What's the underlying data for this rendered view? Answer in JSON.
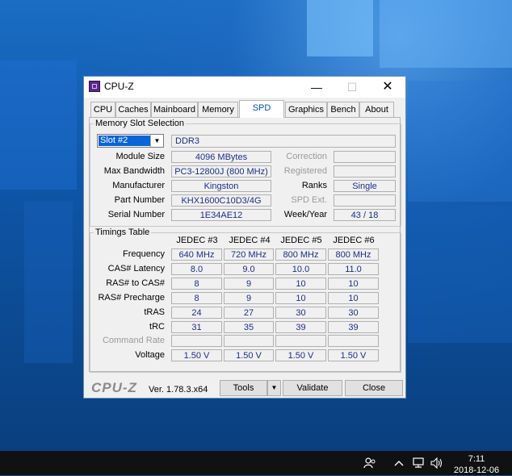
{
  "window": {
    "title": "CPU-Z",
    "minimize": "—",
    "maximize": "☐",
    "close": "✕"
  },
  "tabs": [
    "CPU",
    "Caches",
    "Mainboard",
    "Memory",
    "SPD",
    "Graphics",
    "Bench",
    "About"
  ],
  "active_tab": "SPD",
  "slot_group": {
    "legend": "Memory Slot Selection",
    "slot_selected": "Slot #2",
    "memory_type": "DDR3",
    "labels": {
      "module_size": "Module Size",
      "max_bandwidth": "Max Bandwidth",
      "manufacturer": "Manufacturer",
      "part_number": "Part Number",
      "serial_number": "Serial Number",
      "correction": "Correction",
      "registered": "Registered",
      "ranks": "Ranks",
      "spd_ext": "SPD Ext.",
      "week_year": "Week/Year"
    },
    "values": {
      "module_size": "4096 MBytes",
      "max_bandwidth": "PC3-12800J (800 MHz)",
      "manufacturer": "Kingston",
      "part_number": "KHX1600C10D3/4G",
      "serial_number": "1E34AE12",
      "correction": "",
      "registered": "",
      "ranks": "Single",
      "spd_ext": "",
      "week_year": "43 / 18"
    }
  },
  "timings": {
    "legend": "Timings Table",
    "columns": [
      "JEDEC #3",
      "JEDEC #4",
      "JEDEC #5",
      "JEDEC #6"
    ],
    "rows": [
      {
        "label": "Frequency",
        "values": [
          "640 MHz",
          "720 MHz",
          "800 MHz",
          "800 MHz"
        ]
      },
      {
        "label": "CAS# Latency",
        "values": [
          "8.0",
          "9.0",
          "10.0",
          "11.0"
        ]
      },
      {
        "label": "RAS# to CAS#",
        "values": [
          "8",
          "9",
          "10",
          "10"
        ]
      },
      {
        "label": "RAS# Precharge",
        "values": [
          "8",
          "9",
          "10",
          "10"
        ]
      },
      {
        "label": "tRAS",
        "values": [
          "24",
          "27",
          "30",
          "30"
        ]
      },
      {
        "label": "tRC",
        "values": [
          "31",
          "35",
          "39",
          "39"
        ]
      },
      {
        "label": "Command Rate",
        "values": [
          "",
          "",
          "",
          ""
        ],
        "disabled": true
      },
      {
        "label": "Voltage",
        "values": [
          "1.50 V",
          "1.50 V",
          "1.50 V",
          "1.50 V"
        ]
      }
    ]
  },
  "footer": {
    "brand": "CPU-Z",
    "version": "Ver. 1.78.3.x64",
    "tools": "Tools",
    "validate": "Validate",
    "close": "Close"
  },
  "taskbar": {
    "time": "7:11",
    "date": "2018-12-06"
  }
}
